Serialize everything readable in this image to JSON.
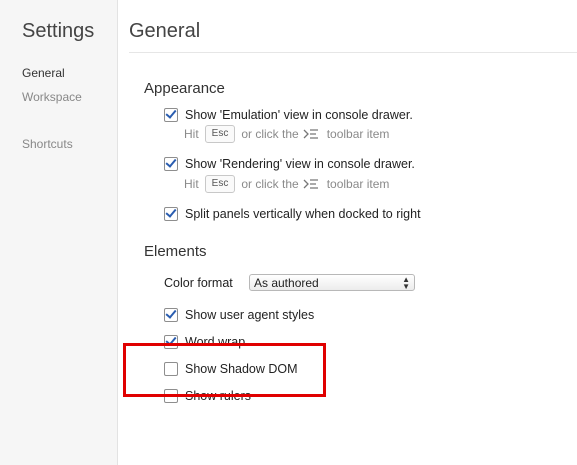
{
  "sidebar": {
    "title": "Settings",
    "items": [
      {
        "label": "General",
        "selected": true
      },
      {
        "label": "Workspace",
        "selected": false
      },
      {
        "label": "Shortcuts",
        "selected": false
      }
    ]
  },
  "main": {
    "title": "General",
    "appearance": {
      "heading": "Appearance",
      "emulation": {
        "label": "Show 'Emulation' view in console drawer.",
        "checked": true
      },
      "emulation_hint": {
        "prefix": "Hit",
        "key": "Esc",
        "middle": "or click the",
        "suffix": "toolbar item"
      },
      "rendering": {
        "label": "Show 'Rendering' view in console drawer.",
        "checked": true
      },
      "rendering_hint": {
        "prefix": "Hit",
        "key": "Esc",
        "middle": "or click the",
        "suffix": "toolbar item"
      },
      "split": {
        "label": "Split panels vertically when docked to right",
        "checked": true
      }
    },
    "elements": {
      "heading": "Elements",
      "color_format": {
        "label": "Color format",
        "value": "As authored"
      },
      "user_agent": {
        "label": "Show user agent styles",
        "checked": true
      },
      "word_wrap": {
        "label": "Word wrap",
        "checked": true
      },
      "shadow_dom": {
        "label": "Show Shadow DOM",
        "checked": false
      },
      "rulers": {
        "label": "Show rulers",
        "checked": false
      }
    }
  },
  "colors": {
    "highlight": "#e00000",
    "checkmark": "#2a5db0"
  }
}
